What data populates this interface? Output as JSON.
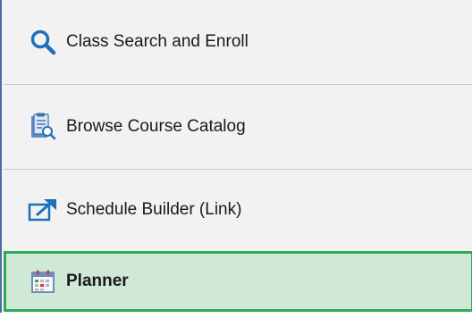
{
  "nav": {
    "items": [
      {
        "label": "Class Search and Enroll",
        "icon": "magnifier-icon",
        "selected": false
      },
      {
        "label": "Browse Course Catalog",
        "icon": "catalog-search-icon",
        "selected": false
      },
      {
        "label": "Schedule Builder (Link)",
        "icon": "external-link-icon",
        "selected": false
      },
      {
        "label": "Planner",
        "icon": "calendar-icon",
        "selected": true
      }
    ]
  },
  "colors": {
    "accent_blue": "#1e6fba",
    "selected_bg": "#cfe9d6",
    "selected_border": "#2eaa5a",
    "panel_bg": "#f2f2f2"
  }
}
